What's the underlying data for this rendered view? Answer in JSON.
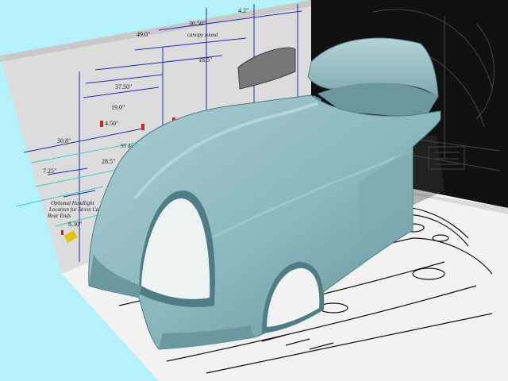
{
  "viewport": {
    "background": "#b4f1fb",
    "blueprint_side": {
      "dimensions": [
        "49.0\"",
        "30.50\"",
        "4.2\"",
        "37.50\"",
        "18.5\"",
        "19.0\"",
        "30.8\"",
        "4.50\"",
        "7.25\"",
        "28.5\"",
        "8.30\""
      ],
      "notes": [
        "canopy round",
        "Optional Headlight",
        "Location for Street Car",
        "Rear Ends",
        "95 deg"
      ]
    },
    "model": {
      "body_color": "#89b6bc",
      "shadow_color": "#4e7d85",
      "highlight_color": "#b8d6da",
      "wall_color": "#111111",
      "floor_paper_color": "#f2f2f2",
      "sheet_color": "#dcdcdc",
      "dimension_line_color": "#1f2fb0",
      "guide_line_color": "#3fc9c4",
      "marker_color": "#e4c300",
      "pin_color": "#d8202a"
    }
  }
}
